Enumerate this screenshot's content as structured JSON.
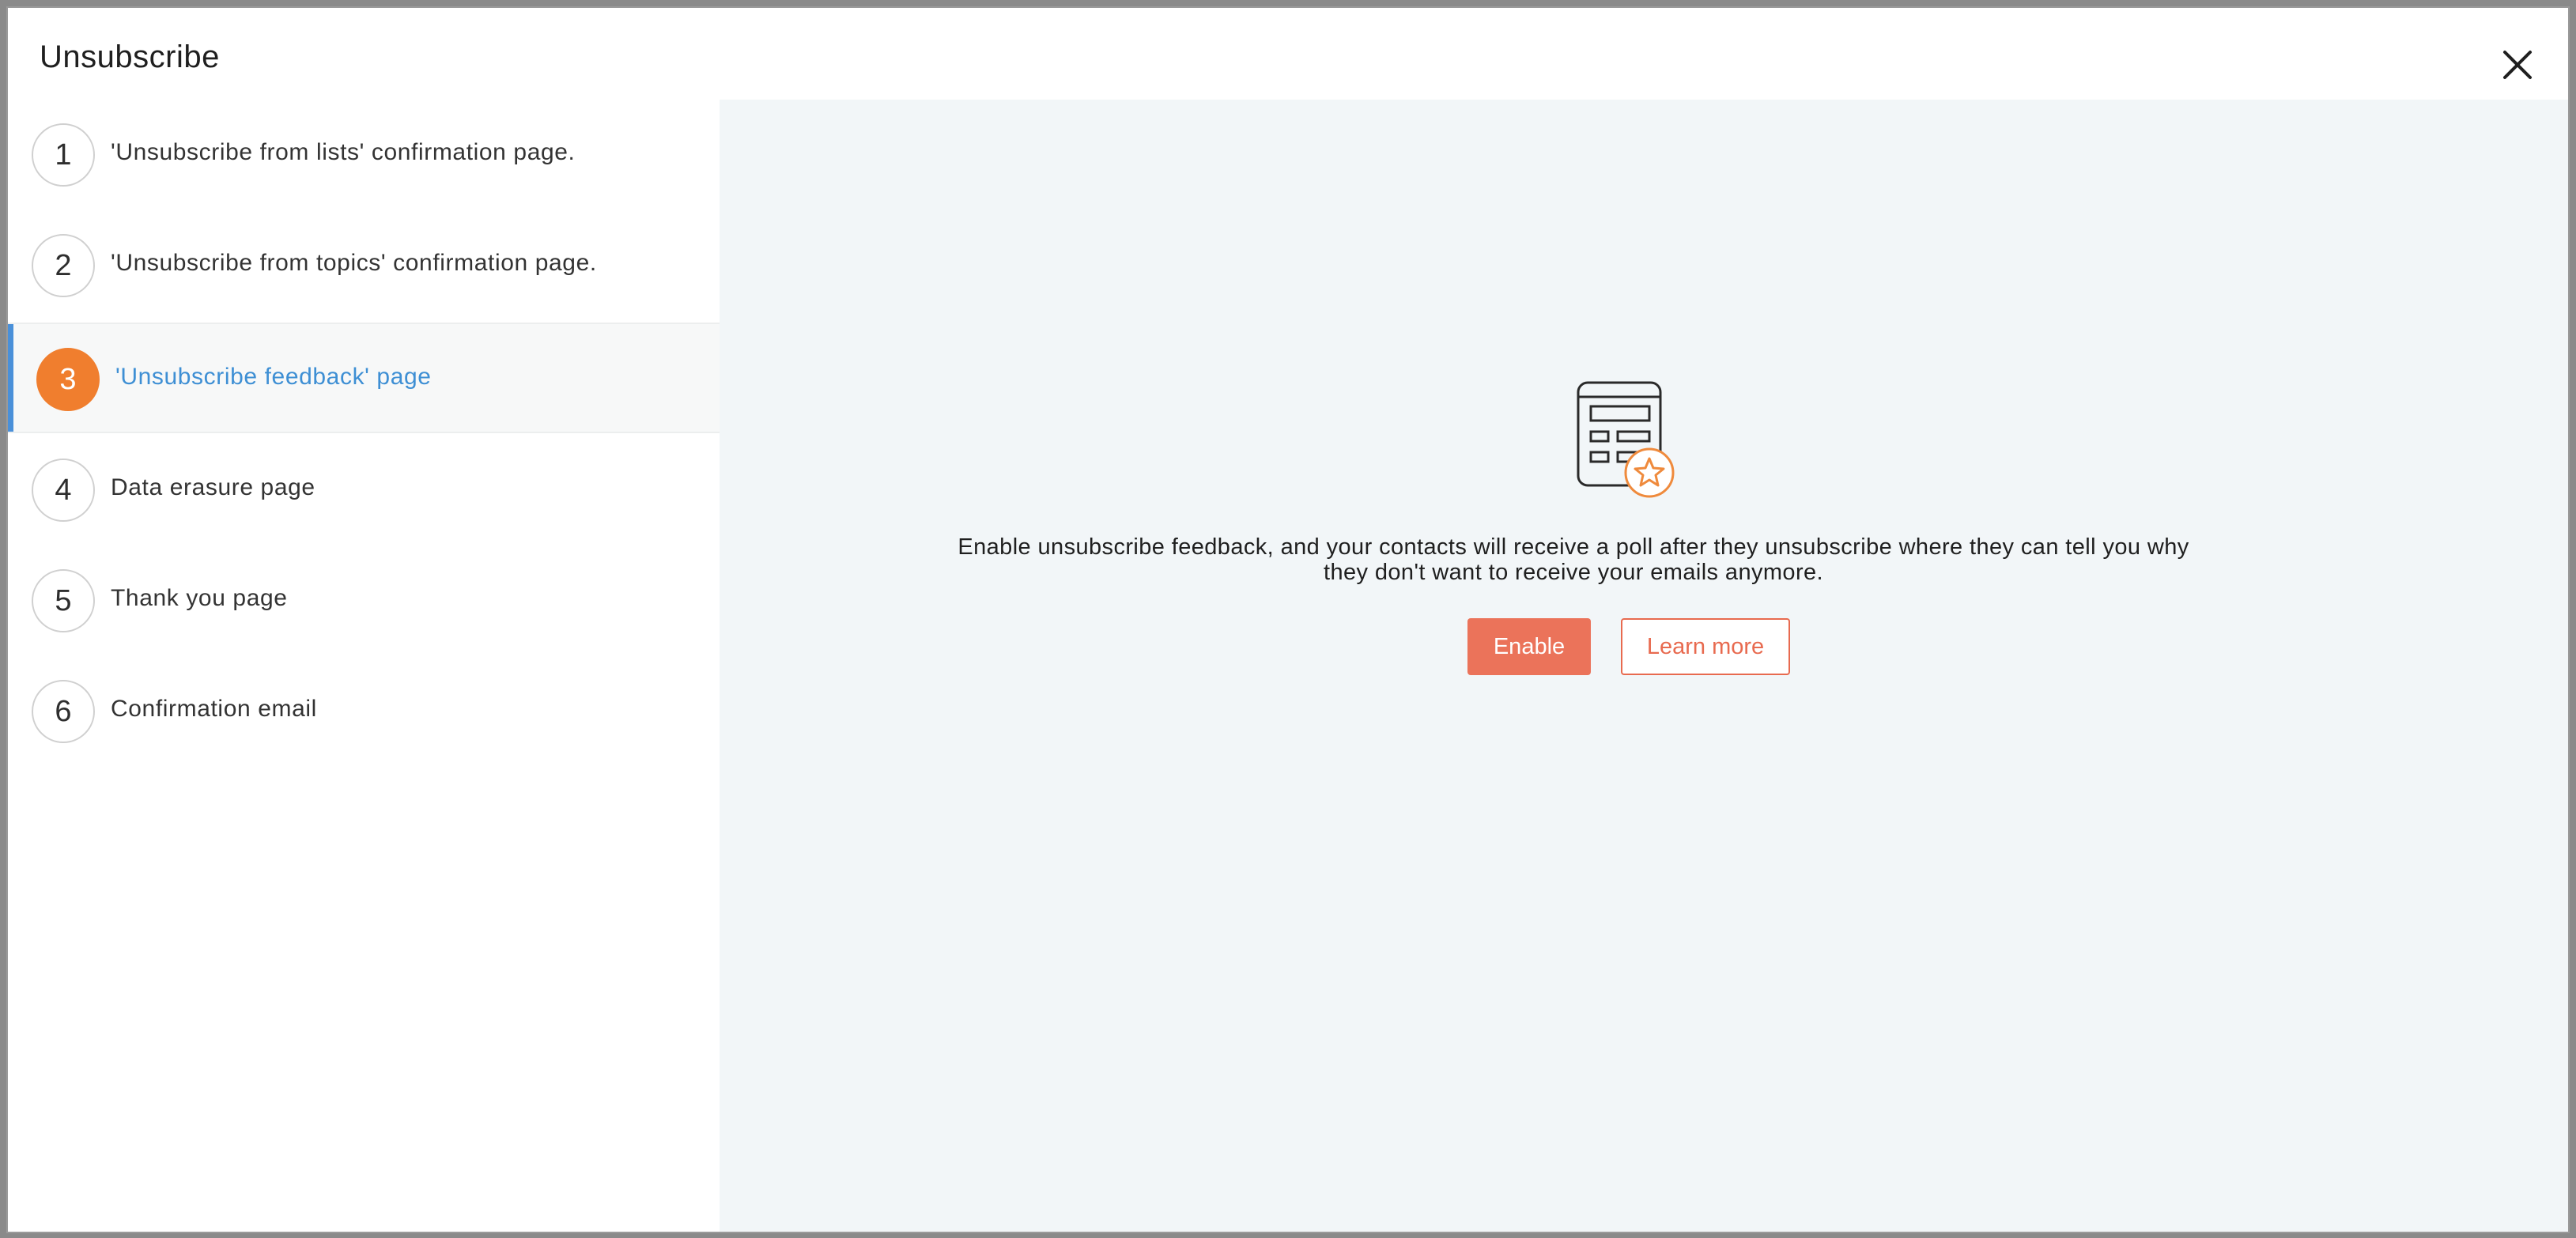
{
  "dialog": {
    "title": "Unsubscribe",
    "close_icon": "close-icon"
  },
  "steps": [
    {
      "number": "1",
      "label": "'Unsubscribe from lists' confirmation page."
    },
    {
      "number": "2",
      "label": "'Unsubscribe from topics' confirmation page."
    },
    {
      "number": "3",
      "label": "'Unsubscribe feedback' page",
      "active": true
    },
    {
      "number": "4",
      "label": "Data erasure page"
    },
    {
      "number": "5",
      "label": "Thank you page"
    },
    {
      "number": "6",
      "label": "Confirmation email"
    }
  ],
  "main": {
    "illustration_icon": "feedback-form-star-icon",
    "description": "Enable unsubscribe feedback, and your contacts will receive a poll after they unsubscribe where they can tell you why they don't want to receive your emails anymore.",
    "enable_label": "Enable",
    "learn_more_label": "Learn more"
  },
  "colors": {
    "accent_orange": "#f07e2e",
    "active_blue": "#3e8fd4",
    "button_coral": "#eb735a",
    "main_bg": "#f2f6f8"
  }
}
